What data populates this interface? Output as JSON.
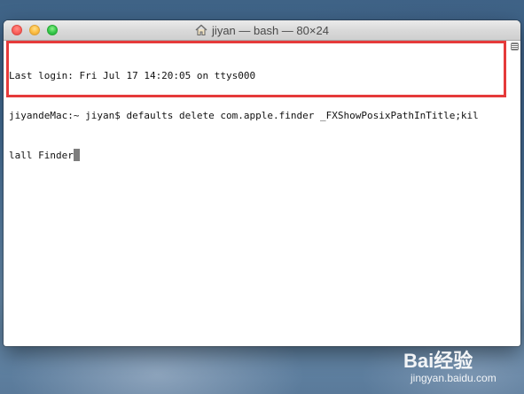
{
  "window": {
    "title": "jiyan — bash — 80×24"
  },
  "terminal": {
    "lines": [
      "Last login: Fri Jul 17 14:20:05 on ttys000",
      "jiyandeMac:~ jiyan$ defaults delete com.apple.finder _FXShowPosixPathInTitle;kil",
      "lall Finder"
    ]
  },
  "watermark": {
    "brand": "Bai经验",
    "url": "jingyan.baidu.com"
  },
  "colors": {
    "highlight": "#e53a3a",
    "close": "#fc605b",
    "minimize": "#fdbc40",
    "maximize": "#34c84a"
  }
}
